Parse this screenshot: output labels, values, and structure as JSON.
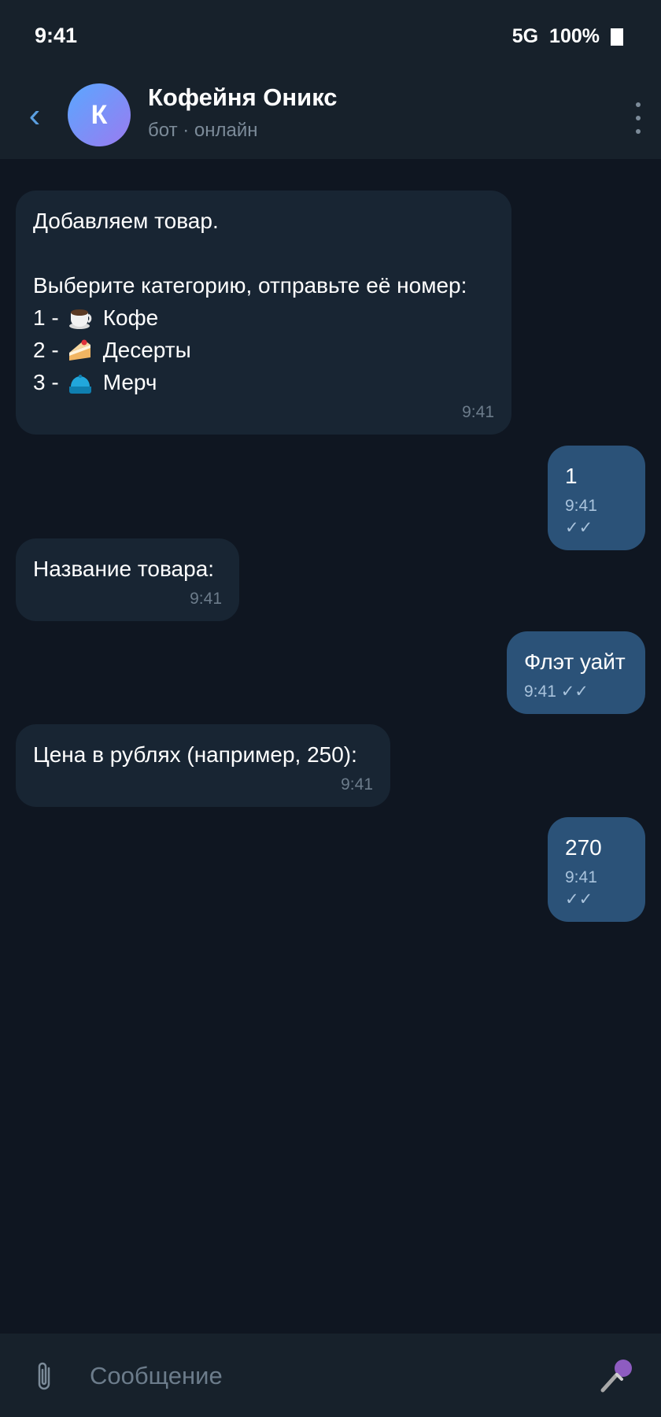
{
  "status": {
    "time": "9:41",
    "network": "5G",
    "battery": "100%"
  },
  "header": {
    "back_icon": "‹",
    "avatar_letter": "К",
    "title": "Кофейня Оникс",
    "subtitle": "бот · онлайн"
  },
  "messages": [
    {
      "direction": "in",
      "intro": "Добавляем товар.\n\nВыберите категорию, отправьте её номер:",
      "options": [
        {
          "prefix": "1 -",
          "icon": "coffee-cup-icon",
          "label": "Кофе"
        },
        {
          "prefix": "2 -",
          "icon": "cake-icon",
          "label": "Десерты"
        },
        {
          "prefix": "3 -",
          "icon": "cap-icon",
          "label": "Мерч"
        }
      ],
      "time": "9:41"
    },
    {
      "direction": "out",
      "text": "1",
      "time": "9:41 ✓✓"
    },
    {
      "direction": "in",
      "text": "Название товара:",
      "time": "9:41"
    },
    {
      "direction": "out",
      "text": "Флэт уайт",
      "time": "9:41 ✓✓"
    },
    {
      "direction": "in",
      "text": "Цена в рублях (например, 250):",
      "time": "9:41"
    },
    {
      "direction": "out",
      "text": "270",
      "time": "9:41 ✓✓"
    }
  ],
  "composer": {
    "placeholder": "Сообщение"
  },
  "colors": {
    "background": "#0f1621",
    "panel": "#17212b",
    "incoming": "#182533",
    "outgoing": "#2b5278",
    "accent": "#5b9fe0"
  }
}
